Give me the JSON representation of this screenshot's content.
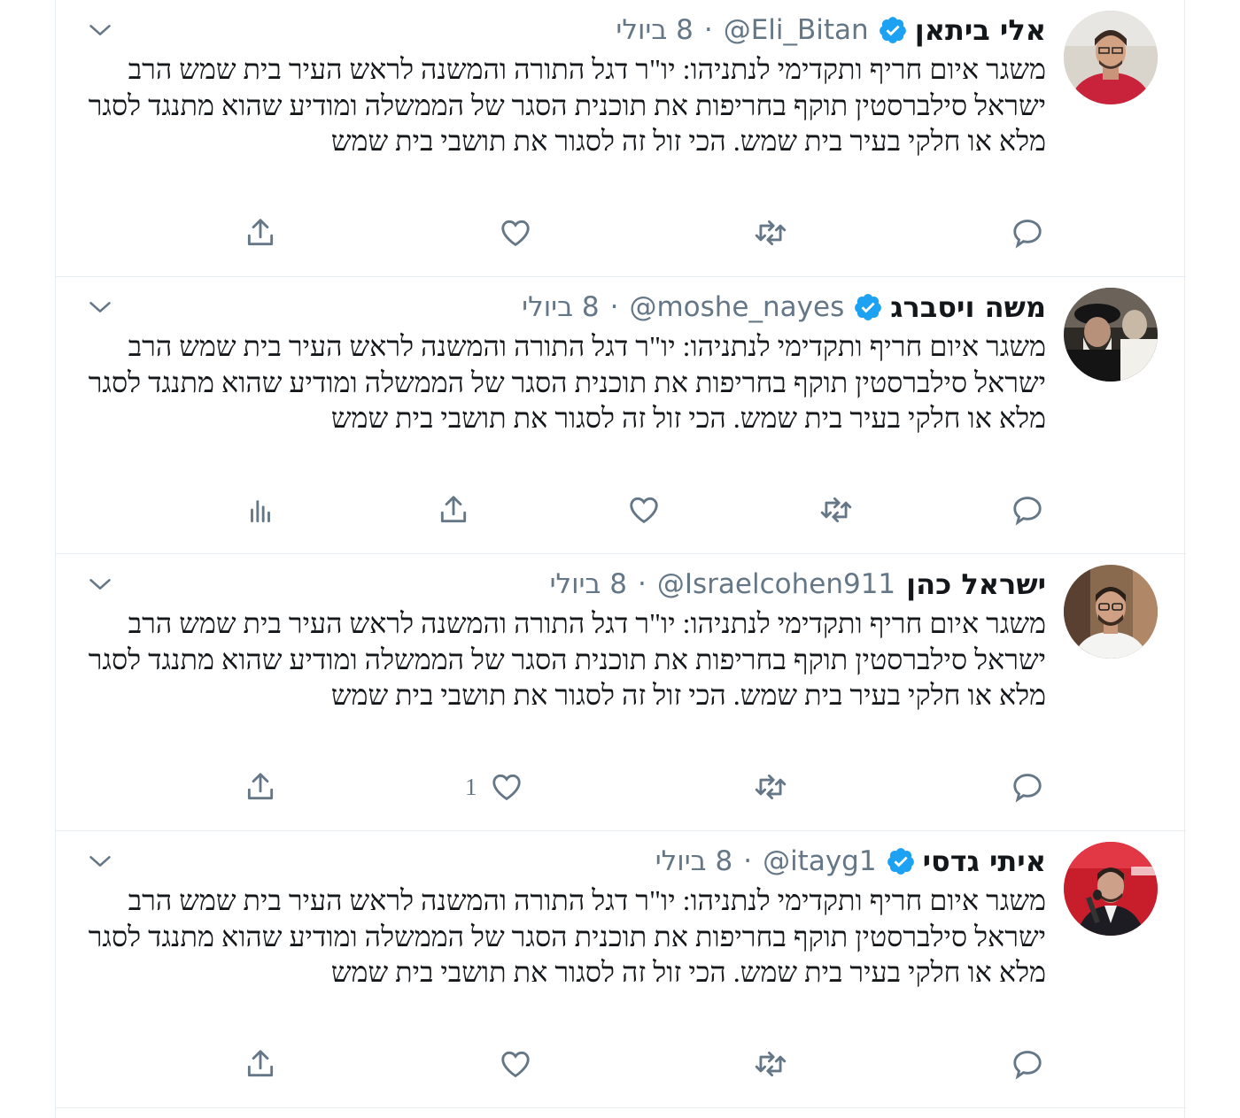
{
  "colors": {
    "accent": "#1da1f2",
    "muted": "#657786",
    "text": "#14171a",
    "border": "#e6ecf0"
  },
  "tweets": [
    {
      "name": "אלי ביתאן",
      "handle": "@Eli_Bitan",
      "date": "8 ביולי",
      "verified": true,
      "text": "משגר איום חריף ותקדימי לנתניהו: יו\"ר דגל התורה והמשנה לראש העיר בית שמש הרב ישראל סילברסטין תוקף בחריפות את תוכנית הסגר של הממשלה ומודיע שהוא מתנגד לסגר מלא או חלקי בעיר בית שמש. הכי זול זה לסגור את תושבי בית שמש",
      "like_count": "",
      "has_analytics": false,
      "avatar": "man-red-shirt"
    },
    {
      "name": "משה ויסברג",
      "handle": "@moshe_nayes",
      "date": "8 ביולי",
      "verified": true,
      "text": "משגר איום חריף ותקדימי לנתניהו: יו\"ר דגל התורה והמשנה לראש העיר בית שמש הרב ישראל סילברסטין תוקף בחריפות את תוכנית הסגר של הממשלה ומודיע שהוא מתנגד לסגר מלא או חלקי בעיר בית שמש. הכי זול זה לסגור את תושבי בית שמש",
      "like_count": "",
      "has_analytics": true,
      "avatar": "rabbi-crowd"
    },
    {
      "name": "ישראל כהן",
      "handle": "@Israelcohen911",
      "date": "8 ביולי",
      "verified": false,
      "text": "משגר איום חריף ותקדימי לנתניהו: יו\"ר דגל התורה והמשנה לראש העיר בית שמש הרב ישראל סילברסטין תוקף בחריפות את תוכנית הסגר של הממשלה ומודיע שהוא מתנגד לסגר מלא או חלקי בעיר בית שמש. הכי זול זה לסגור את תושבי בית שמש",
      "like_count": "1",
      "has_analytics": false,
      "avatar": "man-glasses-white-shirt"
    },
    {
      "name": "איתי גדסי",
      "handle": "@itayg1",
      "date": "8 ביולי",
      "verified": true,
      "text": "משגר איום חריף ותקדימי לנתניהו: יו\"ר דגל התורה והמשנה לראש העיר בית שמש הרב ישראל סילברסטין תוקף בחריפות את תוכנית הסגר של הממשלה ומודיע שהוא מתנגד לסגר מלא או חלקי בעיר בית שמש. הכי זול זה לסגור את תושבי בית שמש",
      "like_count": "",
      "has_analytics": false,
      "avatar": "man-microphone-red"
    }
  ]
}
